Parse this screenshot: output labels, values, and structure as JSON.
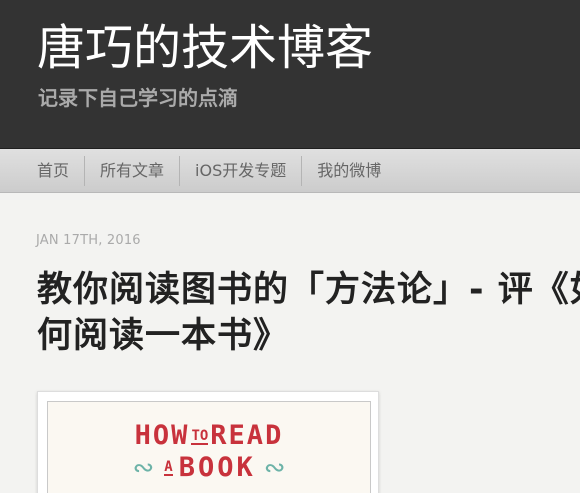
{
  "header": {
    "site_title": "唐巧的技术博客",
    "site_subtitle": "记录下自己学习的点滴"
  },
  "nav": {
    "items": [
      {
        "label": "首页"
      },
      {
        "label": "所有文章"
      },
      {
        "label": "iOS开发专题"
      },
      {
        "label": "我的微博"
      }
    ]
  },
  "post": {
    "date": "JAN 17TH, 2016",
    "title": "教你阅读图书的「方法论」- 评《如何阅读一本书》",
    "cover": {
      "line1_a": "HOW",
      "line1_small": "TO",
      "line1_b": "READ",
      "line2_small": "A",
      "line2_big": "BOOK",
      "ornament": "∾"
    }
  },
  "colors": {
    "header_bg": "#333333",
    "nav_bg": "#d6d6d6",
    "page_bg": "#f3f3f1",
    "cover_red": "#c8323c",
    "cover_teal": "#6db3a8"
  }
}
